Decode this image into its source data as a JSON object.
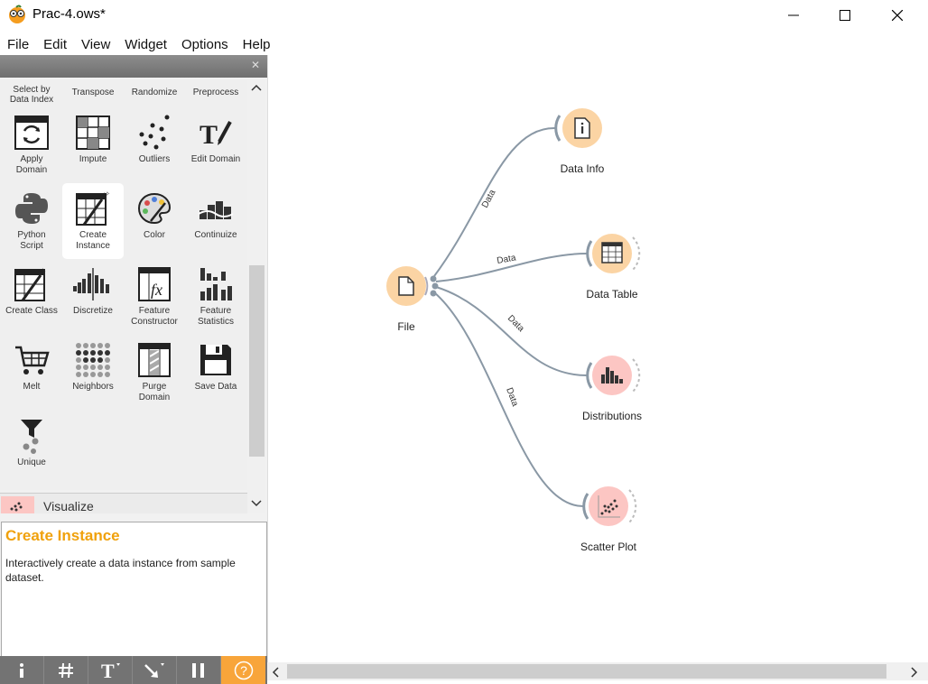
{
  "window": {
    "title": "Prac-4.ows*"
  },
  "menu": [
    "File",
    "Edit",
    "View",
    "Widget",
    "Options",
    "Help"
  ],
  "toolbox": {
    "top_partial": [
      "Select by\nData Index",
      "Transpose",
      "Randomize",
      "Preprocess"
    ],
    "rows": [
      [
        "Apply\nDomain",
        "Impute",
        "Outliers",
        "Edit Domain"
      ],
      [
        "Python\nScript",
        "Create\nInstance",
        "Color",
        "Continuize"
      ],
      [
        "Create Class",
        "Discretize",
        "Feature\nConstructor",
        "Feature\nStatistics"
      ],
      [
        "Melt",
        "Neighbors",
        "Purge\nDomain",
        "Save Data"
      ],
      [
        "Unique"
      ]
    ],
    "selected": "Create\nInstance",
    "category": "Visualize"
  },
  "help": {
    "title": "Create Instance",
    "text": "Interactively create a data instance from sample dataset."
  },
  "bottom_toolbar": [
    "info",
    "grid",
    "text",
    "arrow",
    "pause",
    "help"
  ],
  "workflow": {
    "nodes": [
      {
        "id": "file",
        "label": "File"
      },
      {
        "id": "data-info",
        "label": "Data Info"
      },
      {
        "id": "data-table",
        "label": "Data Table"
      },
      {
        "id": "distributions",
        "label": "Distributions"
      },
      {
        "id": "scatter-plot",
        "label": "Scatter Plot"
      }
    ],
    "links": [
      {
        "from": "File",
        "to": "Data Info",
        "label": "Data"
      },
      {
        "from": "File",
        "to": "Data Table",
        "label": "Data"
      },
      {
        "from": "File",
        "to": "Distributions",
        "label": "Data"
      },
      {
        "from": "File",
        "to": "Scatter Plot",
        "label": "Data"
      }
    ]
  },
  "colors": {
    "data_widget": "#fbd4a4",
    "visualize_widget": "#fcc6c3",
    "accent": "#f0a10c",
    "link": "#8a98a5"
  }
}
